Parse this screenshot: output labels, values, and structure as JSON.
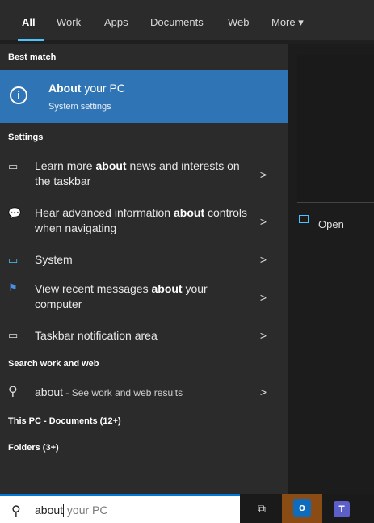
{
  "tabs": [
    {
      "label": "All"
    },
    {
      "label": "Work"
    },
    {
      "label": "Apps"
    },
    {
      "label": "Documents"
    },
    {
      "label": "Web"
    },
    {
      "label": "More"
    }
  ],
  "sections": {
    "best_match": "Best match",
    "settings": "Settings",
    "search_work_web": "Search work and web",
    "this_pc": "This PC - Documents (12+)",
    "folders": "Folders (3+)"
  },
  "best_match": {
    "title_bold": "About",
    "title_rest": " your PC",
    "subtitle": "System settings",
    "icon": "info-icon"
  },
  "settings_items": [
    {
      "pre": "Learn more ",
      "bold": "about",
      "post": " news and interests on the taskbar",
      "icon": "display-icon"
    },
    {
      "pre": "Hear advanced information ",
      "bold": "about",
      "post": " controls when navigating",
      "icon": "chat-icon"
    },
    {
      "pre": "System",
      "bold": "",
      "post": "",
      "icon": "monitor-icon"
    },
    {
      "pre": "View recent messages ",
      "bold": "about",
      "post": " your computer",
      "icon": "flag-icon"
    },
    {
      "pre": "Taskbar notification area",
      "bold": "",
      "post": "",
      "icon": "taskbar-icon"
    }
  ],
  "web_result": {
    "query": "about",
    "suffix": " - See work and web results",
    "icon": "search-icon"
  },
  "right_panel": {
    "open_label": "Open"
  },
  "searchbox": {
    "typed": "about",
    "ghost": " your PC"
  },
  "taskbar": {
    "task_view": "task-view-icon",
    "outlook": "outlook-icon",
    "teams": "teams-icon"
  },
  "colors": {
    "accent": "#2f74b5",
    "panel": "#2b2b2b",
    "highlight": "#4cc2ff"
  }
}
